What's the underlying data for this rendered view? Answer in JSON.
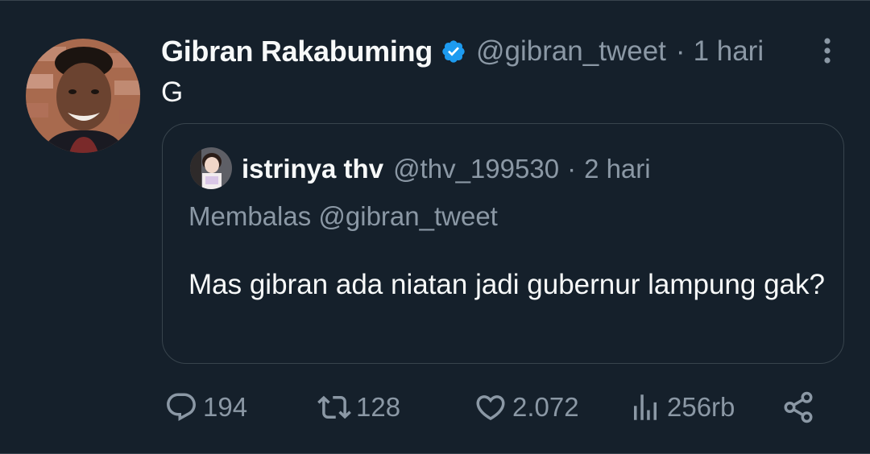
{
  "tweet": {
    "author_name": "Gibran Rakabuming",
    "author_handle": "@gibran_tweet",
    "separator": "·",
    "time": "1 hari",
    "text": "G",
    "verified": true
  },
  "quoted_tweet": {
    "author_name": "istrinya thv",
    "author_handle": "@thv_199530",
    "separator": "·",
    "time": "2 hari",
    "reply_to": "Membalas @gibran_tweet",
    "text": "Mas gibran ada niatan jadi gubernur lampung gak?"
  },
  "actions": {
    "replies": "194",
    "retweets": "128",
    "likes": "2.072",
    "views": "256rb"
  },
  "icons": {
    "more": "more-vertical-icon",
    "reply": "reply-icon",
    "retweet": "retweet-icon",
    "like": "heart-icon",
    "views": "views-icon",
    "share": "share-icon",
    "verified": "verified-badge-icon"
  },
  "colors": {
    "background": "#15202b",
    "text_primary": "#f7f9f9",
    "text_secondary": "#8b98a5",
    "border": "#38444d",
    "verified": "#1d9bf0"
  }
}
